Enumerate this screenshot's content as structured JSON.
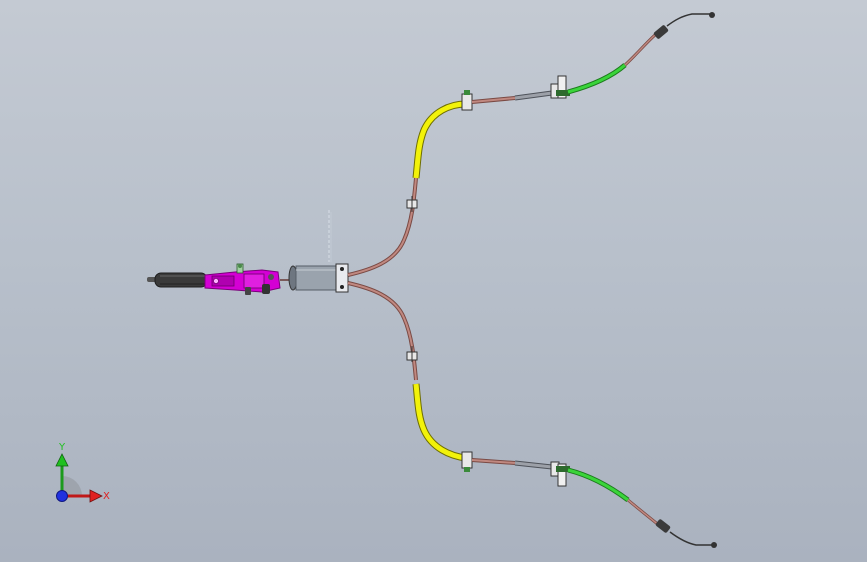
{
  "viewport": {
    "background_top": "#c4cad3",
    "background_bottom": "#aab2bf"
  },
  "model": {
    "parts": [
      {
        "name": "handle-grip",
        "color": "#3a3a3a"
      },
      {
        "name": "lever-assembly",
        "color": "#d400d4"
      },
      {
        "name": "equalizer-housing",
        "color": "#9aa3ad"
      },
      {
        "name": "cable-conduit",
        "color": "#a86a63"
      },
      {
        "name": "cable-sleeve-yellow",
        "color": "#f2f20a"
      },
      {
        "name": "cable-sleeve-green",
        "color": "#3ad43a"
      },
      {
        "name": "cable-steel",
        "color": "#7c8088"
      },
      {
        "name": "mount-bracket",
        "color": "#e8e8e8"
      }
    ]
  },
  "triad": {
    "x_label": "X",
    "y_label": "Y",
    "x_color": "#e02020",
    "y_color": "#20c020",
    "z_color": "#2030e0"
  }
}
